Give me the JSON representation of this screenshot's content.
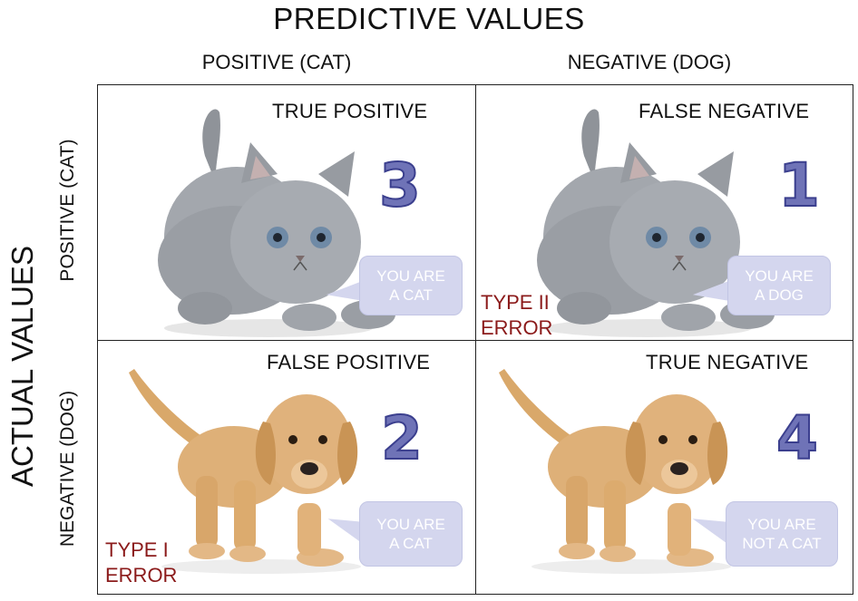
{
  "header": {
    "title": "PREDICTIVE VALUES"
  },
  "columns": {
    "positive": "POSITIVE (CAT)",
    "negative": "NEGATIVE (DOG)"
  },
  "rows": {
    "title": "ACTUAL VALUES",
    "positive": "POSITIVE (CAT)",
    "negative": "NEGATIVE (DOG)"
  },
  "cells": {
    "tp": {
      "label": "TRUE POSITIVE",
      "number": "3",
      "bubble_line1": "YOU ARE",
      "bubble_line2": "A CAT"
    },
    "fn": {
      "label": "FALSE NEGATIVE",
      "number": "1",
      "bubble_line1": "YOU ARE",
      "bubble_line2": "A DOG",
      "error_line1": "TYPE II",
      "error_line2": "ERROR"
    },
    "fp": {
      "label": "FALSE POSITIVE",
      "number": "2",
      "bubble_line1": "YOU ARE",
      "bubble_line2": "A CAT",
      "error_line1": "TYPE I",
      "error_line2": "ERROR"
    },
    "tn": {
      "label": "TRUE NEGATIVE",
      "number": "4",
      "bubble_line1": "YOU ARE",
      "bubble_line2": "NOT A CAT"
    }
  },
  "colors": {
    "number_fill": "#6f73b7",
    "bubble": "#d4d6ee",
    "error": "#8b1a1a",
    "cat_fur": "#9a9ea4",
    "dog_fur": "#d9a86a"
  },
  "icons": {
    "cat": "kitten-illustration",
    "dog": "puppy-illustration"
  }
}
